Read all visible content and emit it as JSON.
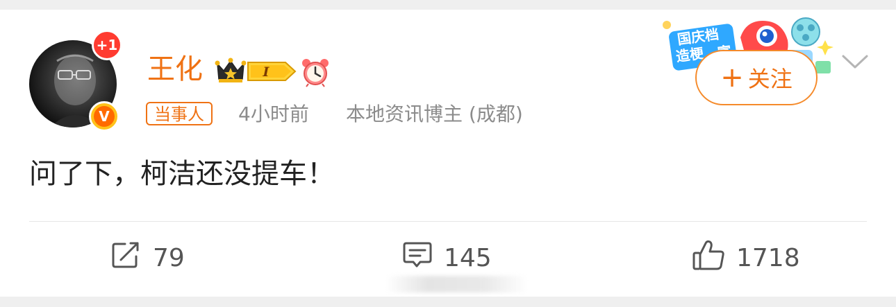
{
  "post": {
    "author": {
      "name": "王化",
      "notification_badge": "+1",
      "verified_mark": "V",
      "level_badge": "I",
      "role_tag": "当事人"
    },
    "time": "4小时前",
    "source": "本地资讯博主 (成都)",
    "text": "问了下，柯洁还没提车！",
    "follow_label": "关注",
    "follow_plus": "+",
    "promo_sticker_text": [
      "国庆档",
      "造梗",
      "富"
    ],
    "actions": {
      "repost_count": "79",
      "comment_count": "145",
      "like_count": "1718"
    }
  },
  "colors": {
    "accent": "#ef7214",
    "notif_badge": "#ff3b30",
    "meta_text": "#8b8b8b",
    "body_text": "#222222"
  }
}
